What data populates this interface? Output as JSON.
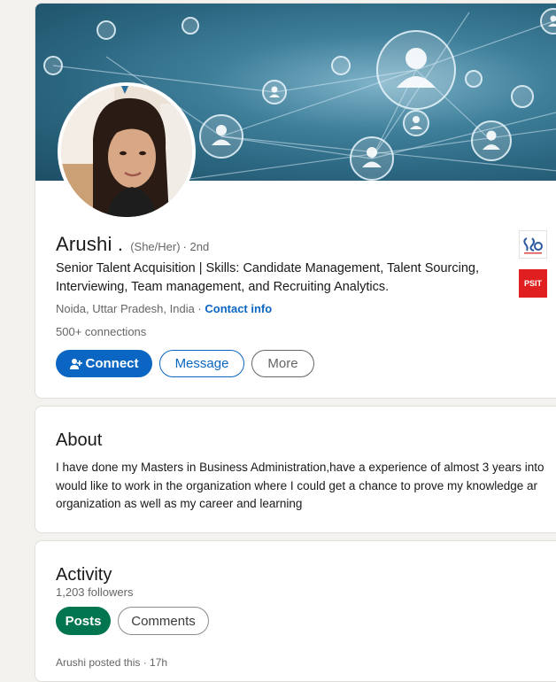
{
  "profile": {
    "name": "Arushi .",
    "pronouns": "(She/Her)",
    "degree": "· 2nd",
    "headline": "Senior Talent Acquisition | Skills: Candidate Management, Talent Sourcing, Interviewing, Team management, and Recruiting Analytics.",
    "location": "Noida, Uttar Pradesh, India ·",
    "contact_info": "Contact info",
    "connections": "500+ connections",
    "buttons": {
      "connect": "Connect",
      "message": "Message",
      "more": "More"
    },
    "logos": {
      "education_1_icon": "institution-logo",
      "education_2_text": "PSIT"
    }
  },
  "about": {
    "title": "About",
    "lines": [
      "I have done my Masters in Business Administration,have a experience of almost 3 years into",
      "would like to work in the organization where I could get a chance to prove my knowledge ar",
      "organization as well as my career and learning"
    ]
  },
  "activity": {
    "title": "Activity",
    "followers": "1,203 followers",
    "tabs": {
      "posts": "Posts",
      "comments": "Comments"
    },
    "preview": "Arushi posted this · 17h"
  },
  "colors": {
    "brand_blue": "#0a66c2",
    "active_green": "#01754f",
    "page_bg": "#f4f2ee"
  }
}
